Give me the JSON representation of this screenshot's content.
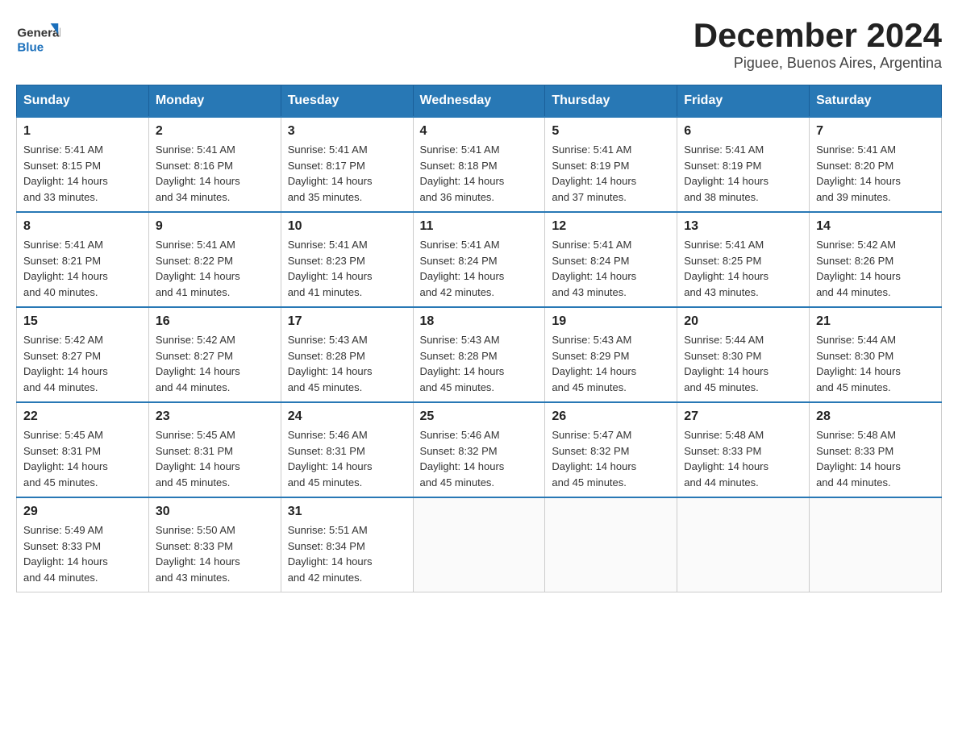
{
  "header": {
    "logo_line1": "General",
    "logo_line2": "Blue",
    "title": "December 2024",
    "subtitle": "Piguee, Buenos Aires, Argentina"
  },
  "weekdays": [
    "Sunday",
    "Monday",
    "Tuesday",
    "Wednesday",
    "Thursday",
    "Friday",
    "Saturday"
  ],
  "weeks": [
    [
      {
        "day": "1",
        "sunrise": "5:41 AM",
        "sunset": "8:15 PM",
        "daylight": "14 hours and 33 minutes."
      },
      {
        "day": "2",
        "sunrise": "5:41 AM",
        "sunset": "8:16 PM",
        "daylight": "14 hours and 34 minutes."
      },
      {
        "day": "3",
        "sunrise": "5:41 AM",
        "sunset": "8:17 PM",
        "daylight": "14 hours and 35 minutes."
      },
      {
        "day": "4",
        "sunrise": "5:41 AM",
        "sunset": "8:18 PM",
        "daylight": "14 hours and 36 minutes."
      },
      {
        "day": "5",
        "sunrise": "5:41 AM",
        "sunset": "8:19 PM",
        "daylight": "14 hours and 37 minutes."
      },
      {
        "day": "6",
        "sunrise": "5:41 AM",
        "sunset": "8:19 PM",
        "daylight": "14 hours and 38 minutes."
      },
      {
        "day": "7",
        "sunrise": "5:41 AM",
        "sunset": "8:20 PM",
        "daylight": "14 hours and 39 minutes."
      }
    ],
    [
      {
        "day": "8",
        "sunrise": "5:41 AM",
        "sunset": "8:21 PM",
        "daylight": "14 hours and 40 minutes."
      },
      {
        "day": "9",
        "sunrise": "5:41 AM",
        "sunset": "8:22 PM",
        "daylight": "14 hours and 41 minutes."
      },
      {
        "day": "10",
        "sunrise": "5:41 AM",
        "sunset": "8:23 PM",
        "daylight": "14 hours and 41 minutes."
      },
      {
        "day": "11",
        "sunrise": "5:41 AM",
        "sunset": "8:24 PM",
        "daylight": "14 hours and 42 minutes."
      },
      {
        "day": "12",
        "sunrise": "5:41 AM",
        "sunset": "8:24 PM",
        "daylight": "14 hours and 43 minutes."
      },
      {
        "day": "13",
        "sunrise": "5:41 AM",
        "sunset": "8:25 PM",
        "daylight": "14 hours and 43 minutes."
      },
      {
        "day": "14",
        "sunrise": "5:42 AM",
        "sunset": "8:26 PM",
        "daylight": "14 hours and 44 minutes."
      }
    ],
    [
      {
        "day": "15",
        "sunrise": "5:42 AM",
        "sunset": "8:27 PM",
        "daylight": "14 hours and 44 minutes."
      },
      {
        "day": "16",
        "sunrise": "5:42 AM",
        "sunset": "8:27 PM",
        "daylight": "14 hours and 44 minutes."
      },
      {
        "day": "17",
        "sunrise": "5:43 AM",
        "sunset": "8:28 PM",
        "daylight": "14 hours and 45 minutes."
      },
      {
        "day": "18",
        "sunrise": "5:43 AM",
        "sunset": "8:28 PM",
        "daylight": "14 hours and 45 minutes."
      },
      {
        "day": "19",
        "sunrise": "5:43 AM",
        "sunset": "8:29 PM",
        "daylight": "14 hours and 45 minutes."
      },
      {
        "day": "20",
        "sunrise": "5:44 AM",
        "sunset": "8:30 PM",
        "daylight": "14 hours and 45 minutes."
      },
      {
        "day": "21",
        "sunrise": "5:44 AM",
        "sunset": "8:30 PM",
        "daylight": "14 hours and 45 minutes."
      }
    ],
    [
      {
        "day": "22",
        "sunrise": "5:45 AM",
        "sunset": "8:31 PM",
        "daylight": "14 hours and 45 minutes."
      },
      {
        "day": "23",
        "sunrise": "5:45 AM",
        "sunset": "8:31 PM",
        "daylight": "14 hours and 45 minutes."
      },
      {
        "day": "24",
        "sunrise": "5:46 AM",
        "sunset": "8:31 PM",
        "daylight": "14 hours and 45 minutes."
      },
      {
        "day": "25",
        "sunrise": "5:46 AM",
        "sunset": "8:32 PM",
        "daylight": "14 hours and 45 minutes."
      },
      {
        "day": "26",
        "sunrise": "5:47 AM",
        "sunset": "8:32 PM",
        "daylight": "14 hours and 45 minutes."
      },
      {
        "day": "27",
        "sunrise": "5:48 AM",
        "sunset": "8:33 PM",
        "daylight": "14 hours and 44 minutes."
      },
      {
        "day": "28",
        "sunrise": "5:48 AM",
        "sunset": "8:33 PM",
        "daylight": "14 hours and 44 minutes."
      }
    ],
    [
      {
        "day": "29",
        "sunrise": "5:49 AM",
        "sunset": "8:33 PM",
        "daylight": "14 hours and 44 minutes."
      },
      {
        "day": "30",
        "sunrise": "5:50 AM",
        "sunset": "8:33 PM",
        "daylight": "14 hours and 43 minutes."
      },
      {
        "day": "31",
        "sunrise": "5:51 AM",
        "sunset": "8:34 PM",
        "daylight": "14 hours and 42 minutes."
      },
      null,
      null,
      null,
      null
    ]
  ],
  "labels": {
    "sunrise": "Sunrise:",
    "sunset": "Sunset:",
    "daylight": "Daylight:"
  }
}
